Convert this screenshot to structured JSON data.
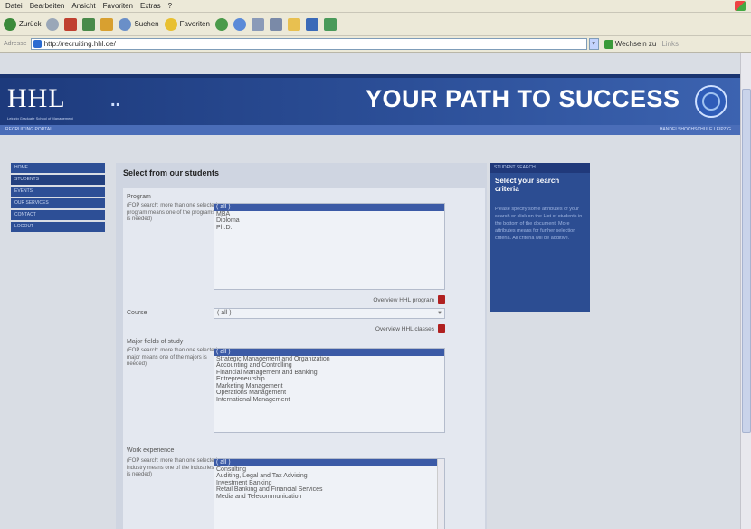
{
  "browser": {
    "menu": [
      "Datei",
      "Bearbeiten",
      "Ansicht",
      "Favoriten",
      "Extras",
      "?"
    ],
    "toolbar": {
      "back": "Zurück",
      "search": "Suchen",
      "favorites": "Favoriten"
    },
    "address_label": "Adresse",
    "address_value": "http://recruiting.hhl.de/",
    "go_label": "Wechseln zu",
    "links_label": "Links"
  },
  "header": {
    "logo": "HHL",
    "logo_dots": "..",
    "logo_sub": "Leipzig Graduate School of Management",
    "slogan": "YOUR PATH TO SUCCESS",
    "subbar_left": "RECRUITING PORTAL",
    "subbar_right": "HANDELSHOCHSCHULE LEIPZIG"
  },
  "nav": [
    "HOME",
    "STUDENTS",
    "EVENTS",
    "OUR SERVICES",
    "CONTACT",
    "LOGOUT"
  ],
  "content": {
    "title": "Select from our students",
    "program": {
      "label": "Program",
      "note": "(FOP search: more than one selected program means one of the programs is needed)",
      "options": [
        "( all )",
        "MBA",
        "Diploma",
        "Ph.D."
      ],
      "overview": "Overview HHL program"
    },
    "course": {
      "label": "Course",
      "value": "( all )",
      "overview": "Overview HHL classes"
    },
    "major": {
      "label": "Major fields of study",
      "note": "(FOP search: more than one selected major means one of the majors is needed)",
      "options": [
        "( all )",
        "Strategic Management and Organization",
        "Accounting and Controlling",
        "Financial Management and Banking",
        "Entrepreneurship",
        "Marketing Management",
        "Operations Management",
        "International Management"
      ]
    },
    "work": {
      "label": "Work experience",
      "note": "(FOP search: more than one selected industry means one of the industries is needed)",
      "options": [
        "( all )",
        "Consulting",
        "Auditing, Legal and Tax Advising",
        "Investment Banking",
        "Retail Banking and Financial Services",
        "Media and Telecommunication"
      ]
    }
  },
  "sidebar_panel": {
    "header": "STUDENT SEARCH",
    "title": "Select your search criteria",
    "text": "Please specify some attributes of your search or click on the List of students in the bottom of the document. More attributes means for further selection criteria. All criteria will be additive."
  },
  "colors": {
    "banner": "#2c4f98",
    "nav": "#2d4f96",
    "selection": "#3b5aa6"
  }
}
